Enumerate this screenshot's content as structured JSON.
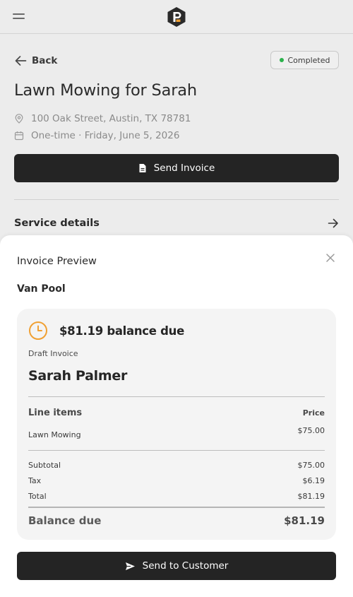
{
  "header": {
    "menu_icon": "hamburger-menu-icon",
    "logo_icon": "app-logo-icon"
  },
  "job": {
    "back_label": "Back",
    "status": "Completed",
    "status_color": "#2bb24c",
    "title": "Lawn Mowing for Sarah",
    "address": "100 Oak Street, Austin, TX 78781",
    "schedule": "One-time · Friday, June 5, 2026",
    "send_invoice_label": "Send Invoice",
    "service_details_label": "Service details"
  },
  "invoice_preview": {
    "title": "Invoice Preview",
    "business_name": "Van Pool",
    "balance_due_headline": "$81.19 balance due",
    "clock_color": "#f0a033",
    "draft_label": "Draft Invoice",
    "customer_name": "Sarah Palmer",
    "line_items_header": "Line items",
    "price_header": "Price",
    "line_items": [
      {
        "name": "Lawn Mowing",
        "price": "$75.00"
      }
    ],
    "subtotal_label": "Subtotal",
    "subtotal": "$75.00",
    "tax_label": "Tax",
    "tax": "$6.19",
    "total_label": "Total",
    "total": "$81.19",
    "balance_due_label": "Balance due",
    "balance_due": "$81.19",
    "send_button_label": "Send to Customer"
  }
}
